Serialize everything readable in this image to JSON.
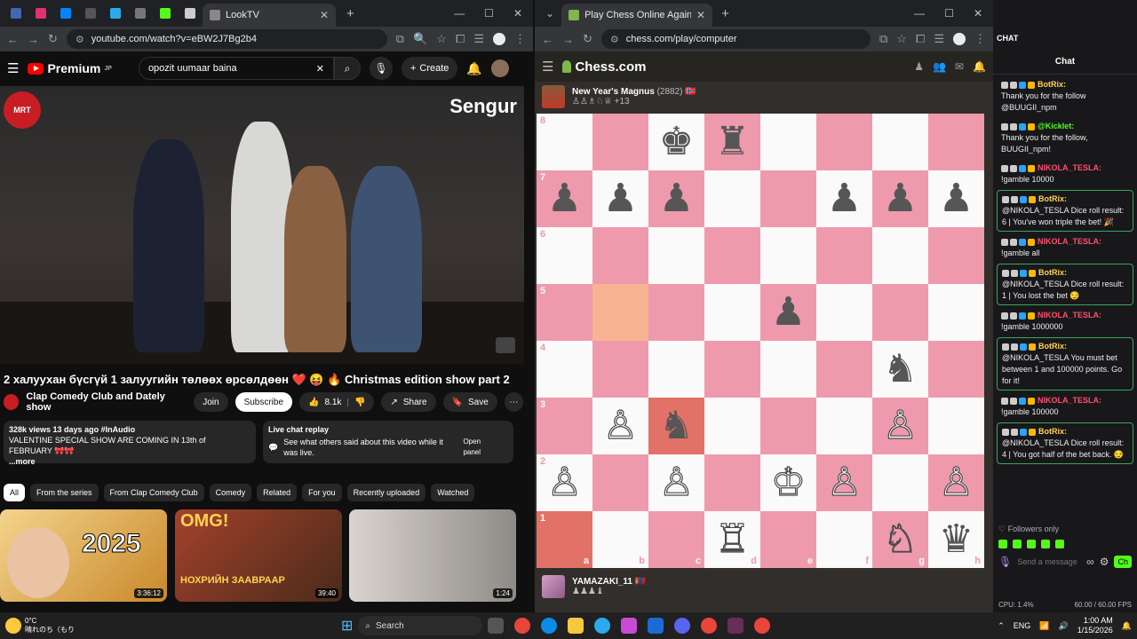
{
  "yt_window": {
    "tabs": [
      {
        "label": "LookTV"
      }
    ],
    "url": "youtube.com/watch?v=eBW2J7Bg2b4",
    "logo": "Premium",
    "logo_sup": "JP",
    "search_value": "opozit uumaar baina",
    "create_label": "Create",
    "video_brand": "Sengur",
    "video_title": "2 халуухан бүсгүй 1 залуугийн төлөөх өрсөлдөөн ❤️ 😝 🔥 Christmas edition show part 2",
    "channel_name": "Clap Comedy Club and Dately show",
    "join_label": "Join",
    "subscribe_label": "Subscribe",
    "likes": "8.1k",
    "share_label": "Share",
    "save_label": "Save",
    "desc_meta": "328k views  13 days ago  #InAudio",
    "desc_text": "VALENTINE SPECIAL SHOW ARE COMING IN 13th of FEBRUARY 🎀🎀",
    "desc_more": "...more",
    "replay_title": "Live chat replay",
    "replay_text": "See what others said about this video while it was live.",
    "open_panel": "Open panel",
    "chips": [
      "All",
      "From the series",
      "From Clap Comedy Club",
      "Comedy",
      "Related",
      "For you",
      "Recently uploaded",
      "Watched"
    ],
    "thumbs": [
      {
        "text": "2025",
        "duration": "3:36:12"
      },
      {
        "text": "OMG!",
        "sub": "НОХРИЙН ЗААВРААР",
        "duration": "39:40"
      },
      {
        "text": "",
        "duration": "1:24"
      }
    ]
  },
  "chess_window": {
    "tab_label": "Play Chess Online Against the C",
    "url": "chess.com/play/computer",
    "logo": "Chess.com",
    "opponent": {
      "name": "New Year's Magnus",
      "rating": "(2882)",
      "captured": "+13"
    },
    "me": {
      "name": "YAMAZAKI_11"
    },
    "ranks": [
      "8",
      "7",
      "6",
      "5",
      "4",
      "3",
      "2",
      "1"
    ],
    "files": [
      "a",
      "b",
      "c",
      "d",
      "e",
      "f",
      "g",
      "h"
    ],
    "board": [
      [
        "",
        "",
        "♚",
        "♜",
        "",
        "",
        "",
        ""
      ],
      [
        "♟",
        "♟",
        "♟",
        "",
        "",
        "♟",
        "♟",
        "♟"
      ],
      [
        "",
        "",
        "",
        "",
        "",
        "",
        "",
        ""
      ],
      [
        "",
        "",
        "",
        "",
        "♟",
        "",
        "",
        ""
      ],
      [
        "",
        "",
        "",
        "",
        "",
        "",
        "♞",
        ""
      ],
      [
        "",
        "♙",
        "♞",
        "",
        "",
        "",
        "♙",
        ""
      ],
      [
        "♙",
        "",
        "♙",
        "",
        "♔",
        "♙",
        "",
        "♙"
      ],
      [
        "",
        "",
        "",
        "♖",
        "",
        "",
        "♘",
        "♛"
      ]
    ]
  },
  "chat": {
    "section": "CHAT",
    "title": "Chat",
    "messages": [
      {
        "user": "BotRix:",
        "text": "Thank you for the follow @BUUGII_npm",
        "bot": false,
        "color": "#ffd34f"
      },
      {
        "user": "@Kicklet:",
        "text": "Thank you for the follow, BUUGII_npm!",
        "bot": false,
        "color": "#53fc18"
      },
      {
        "user": "NIKOLA_TESLA:",
        "text": "!gamble 10000",
        "bot": false,
        "color": "#ff4f6d"
      },
      {
        "user": "BotRix:",
        "text": "@NIKOLA_TESLA Dice roll result: 6 | You've won triple the bet! 🎉",
        "bot": true,
        "color": "#ffd34f"
      },
      {
        "user": "NIKOLA_TESLA:",
        "text": "!gamble all",
        "bot": false,
        "color": "#ff4f6d"
      },
      {
        "user": "BotRix:",
        "text": "@NIKOLA_TESLA Dice roll result: 1 | You lost the bet 😏",
        "bot": true,
        "color": "#ffd34f"
      },
      {
        "user": "NIKOLA_TESLA:",
        "text": "!gamble 1000000",
        "bot": false,
        "color": "#ff4f6d"
      },
      {
        "user": "BotRix:",
        "text": "@NIKOLA_TESLA You must bet between 1 and 100000 points. Go for it!",
        "bot": true,
        "color": "#ffd34f"
      },
      {
        "user": "NIKOLA_TESLA:",
        "text": "!gamble 100000",
        "bot": false,
        "color": "#ff4f6d"
      },
      {
        "user": "BotRix:",
        "text": "@NIKOLA_TESLA Dice roll result: 4 | You got half of the bet back. 😏",
        "bot": true,
        "color": "#ffd34f"
      }
    ],
    "followers_only": "Followers only",
    "send_placeholder": "Send a message",
    "chat_button": "Ch"
  },
  "status": {
    "cpu": "CPU: 1.4%",
    "fps": "60.00 / 60.00 FPS"
  },
  "taskbar": {
    "weather_temp": "0°C",
    "weather_text": "晴れのち〈もり",
    "search": "Search",
    "lang": "ENG",
    "time": "1:00 AM",
    "date": "1/15/2026"
  }
}
